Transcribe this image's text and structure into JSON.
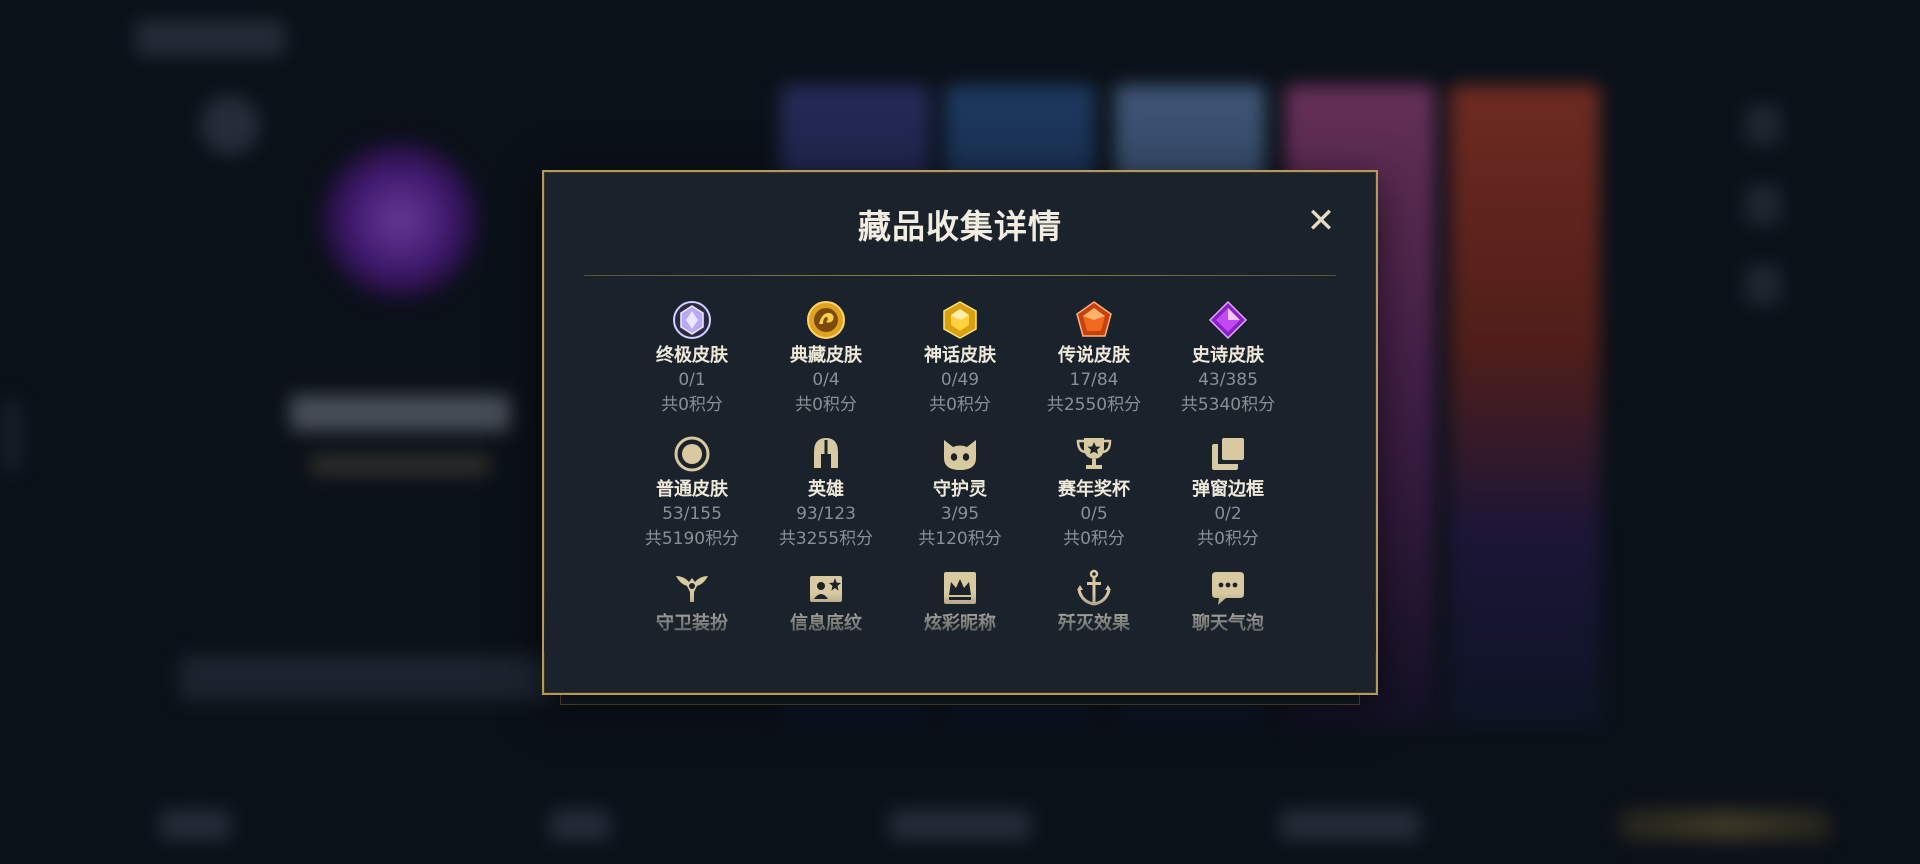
{
  "modal": {
    "title": "藏品收集详情",
    "close_symbol": "✕",
    "items": [
      {
        "label": "终极皮肤",
        "count": "0/1",
        "points": "共0积分",
        "icon": "ultimate-gem-icon"
      },
      {
        "label": "典藏皮肤",
        "count": "0/4",
        "points": "共0积分",
        "icon": "dragon-coin-icon"
      },
      {
        "label": "神话皮肤",
        "count": "0/49",
        "points": "共0积分",
        "icon": "mythic-gem-icon"
      },
      {
        "label": "传说皮肤",
        "count": "17/84",
        "points": "共2550积分",
        "icon": "legendary-gem-icon"
      },
      {
        "label": "史诗皮肤",
        "count": "43/385",
        "points": "共5340积分",
        "icon": "epic-gem-icon"
      },
      {
        "label": "普通皮肤",
        "count": "53/155",
        "points": "共5190积分",
        "icon": "ring-icon"
      },
      {
        "label": "英雄",
        "count": "93/123",
        "points": "共3255积分",
        "icon": "helmet-icon"
      },
      {
        "label": "守护灵",
        "count": "3/95",
        "points": "共120积分",
        "icon": "cat-face-icon"
      },
      {
        "label": "赛年奖杯",
        "count": "0/5",
        "points": "共0积分",
        "icon": "trophy-icon"
      },
      {
        "label": "弹窗边框",
        "count": "0/2",
        "points": "共0积分",
        "icon": "stacked-frames-icon"
      },
      {
        "label": "守卫装扮",
        "count": "",
        "points": "",
        "icon": "ward-icon"
      },
      {
        "label": "信息底纹",
        "count": "",
        "points": "",
        "icon": "info-card-icon"
      },
      {
        "label": "炫彩昵称",
        "count": "",
        "points": "",
        "icon": "crown-icon"
      },
      {
        "label": "歼灭效果",
        "count": "",
        "points": "",
        "icon": "anchor-icon"
      },
      {
        "label": "聊天气泡",
        "count": "",
        "points": "",
        "icon": "chat-bubble-icon"
      }
    ]
  },
  "colors": {
    "modal_bg": "#1a222b",
    "modal_border": "#b49a5a",
    "title": "#f2ede0",
    "label": "#efe9da",
    "muted": "#8a8f96",
    "icon_gold": "#d9c9a0"
  }
}
